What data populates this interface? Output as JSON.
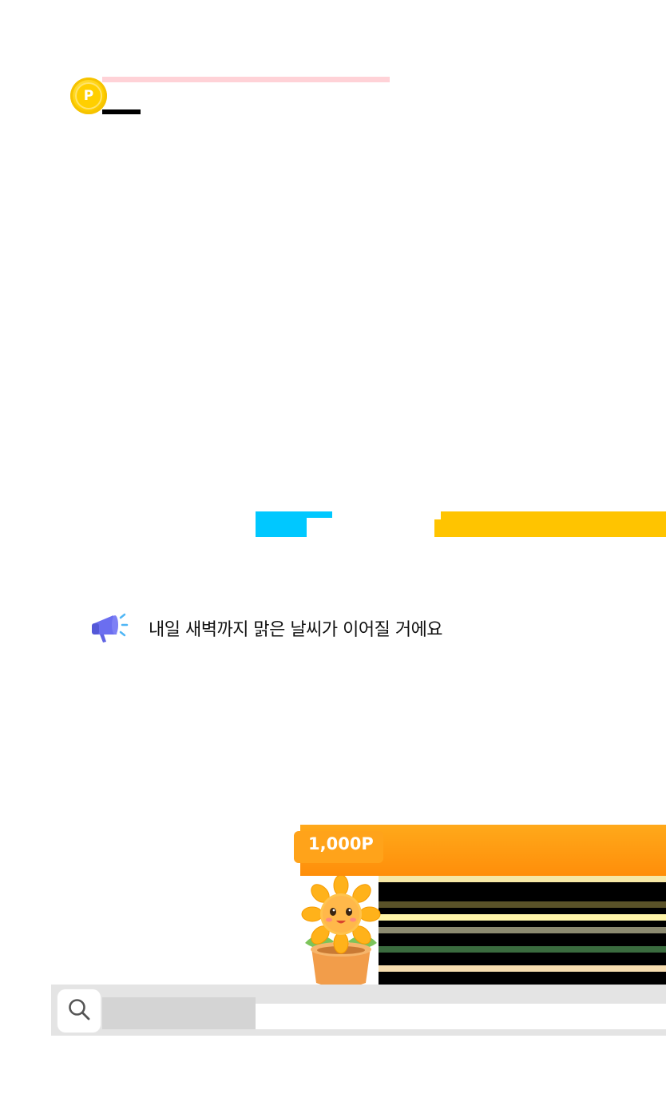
{
  "header": {
    "coin_label": "P",
    "coin_icon": "point-coin-icon"
  },
  "notice": {
    "icon": "megaphone-icon",
    "text": "내일 새벽까지 맑은 날씨가 이어질 거에요"
  },
  "reward": {
    "points_label": "1,000P",
    "character_icon": "sunflower-pot-icon"
  },
  "search": {
    "icon": "search-icon"
  },
  "colors": {
    "coin": "#ffcf00",
    "accent_pink": "#ffd2d7",
    "accent_cyan": "#00c8ff",
    "accent_yellow": "#ffc400",
    "banner_orange": "#ff9a10",
    "search_track": "#e4e4e4"
  }
}
